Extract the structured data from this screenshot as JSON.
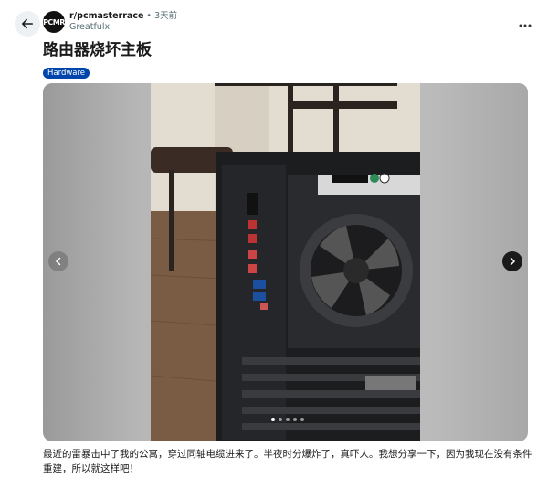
{
  "post": {
    "subreddit": "r/pcmasterrace",
    "avatar_text": "PCMR",
    "separator": "•",
    "time": "3天前",
    "author": "Greatfulx",
    "title": "路由器烧坏主板",
    "flair": "Hardware",
    "body": "最近的雷暴击中了我的公寓，穿过同轴电缆进来了。半夜时分爆炸了，真吓人。我想分享一下，因为我现在没有条件重建，所以就这样吧！"
  },
  "gallery": {
    "image_count": 5,
    "active_index": 0
  },
  "icons": {
    "back": "arrow-left-icon",
    "more": "more-horizontal-icon",
    "prev": "chevron-left-icon",
    "next": "chevron-right-icon"
  },
  "colors": {
    "flair_bg": "#0045ac",
    "next_button_bg": "#1a1a1b"
  }
}
